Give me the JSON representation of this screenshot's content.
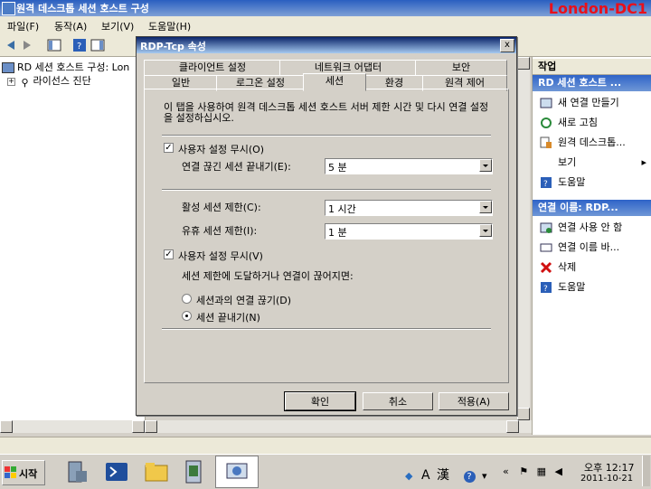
{
  "window": {
    "title": "원격 데스크톱 세션 호스트 구성",
    "server_badge": "London-DC1"
  },
  "menubar": [
    "파일(F)",
    "동작(A)",
    "보기(V)",
    "도움말(H)"
  ],
  "tree": {
    "root": "RD 세션 호스트 구성: Lon",
    "child": "라이선스 진단"
  },
  "dialog": {
    "title": "RDP-Tcp 속성",
    "close": "x",
    "tabs_row1": [
      "클라이언트 설정",
      "네트워크 어댑터",
      "보안"
    ],
    "tabs_row2": [
      "일반",
      "로그온 설정",
      "세션",
      "환경",
      "원격 제어"
    ],
    "description": "이 탭을 사용하여 원격 데스크톱 세션 호스트 서버 제한 시간 및 다시 연결 설정을 설정하십시오.",
    "override1_label": "사용자 설정 무시(O)",
    "end_disconnected_label": "연결 끊긴 세션 끝내기(E):",
    "end_disconnected_value": "5 분",
    "active_limit_label": "활성 세션 제한(C):",
    "active_limit_value": "1 시간",
    "idle_limit_label": "유휴 세션 제한(I):",
    "idle_limit_value": "1 분",
    "override2_label": "사용자 설정 무시(V)",
    "limit_reached_label": "세션 제한에 도달하거나 연결이 끊어지면:",
    "radio_disconnect": "세션과의 연결 끊기(D)",
    "radio_end": "세션 끝내기(N)",
    "ok": "확인",
    "cancel": "취소",
    "apply": "적용(A)"
  },
  "actions": {
    "title": "작업",
    "section1": "RD 세션 호스트 ...",
    "items1": [
      "새 연결 만들기",
      "새로 고침",
      "원격 데스크톱...",
      "보기",
      "도움말"
    ],
    "section2": "연결 이름: RDP...",
    "items2": [
      "연결 사용 안 함",
      "연결 이름 바...",
      "삭제",
      "도움말"
    ]
  },
  "taskbar": {
    "start": "시작",
    "ime_a": "A",
    "ime_han": "漢",
    "time": "오후 12:17",
    "date": "2011-10-21"
  }
}
